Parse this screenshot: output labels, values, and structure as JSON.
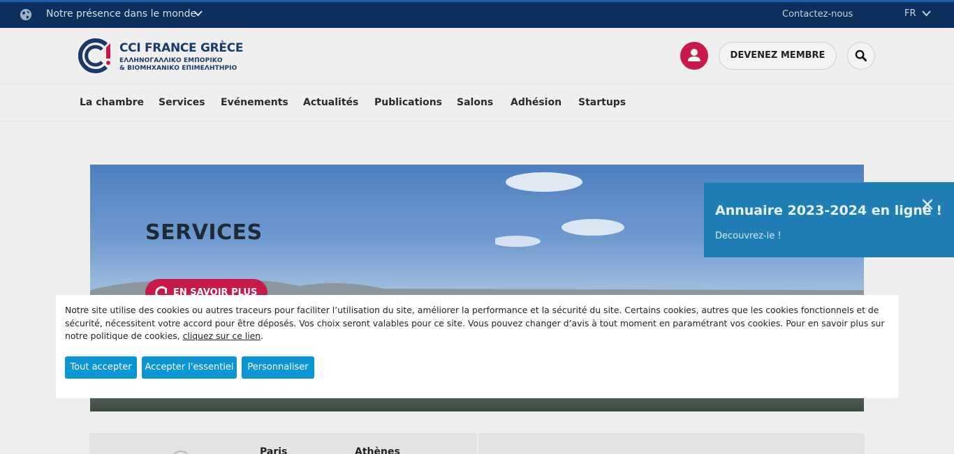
{
  "topbar": {
    "presence_label": "Notre présence dans le monde",
    "contact_label": "Contactez-nous",
    "lang_label": "FR",
    "icons": [
      "globe-icon",
      "chevron-down-icon"
    ]
  },
  "header": {
    "logo_title": "CCI FRANCE GRÈCE",
    "logo_sub1": "ΕΛΛΗΝΟΓΑΛΛΙΚΟ ΕΜΠΟΡΙΚΟ",
    "logo_sub2": "& ΒΙΟΜΗΧΑΝΙΚΟ ΕΠΙΜΕΛΗΤΗΡΙΟ",
    "member_label": "DEVENEZ MEMBRE",
    "icons": [
      "user-icon",
      "search-icon"
    ]
  },
  "nav": {
    "items": [
      "La chambre",
      "Services",
      "Evénements",
      "Actualités",
      "Publications",
      "Salons",
      "Adhésion",
      "Startups"
    ]
  },
  "hero": {
    "title": "SERVICES",
    "button_label": "EN SAVOIR PLUS"
  },
  "popup": {
    "title": "Annuaire 2023-2024 en ligne !",
    "link_label": "Decouvrez-le !"
  },
  "strip": {
    "city1": "Paris",
    "city2": "Athènes"
  },
  "cookie": {
    "text": "Notre site utilise des cookies ou autres traceurs pour faciliter l’utilisation du site, améliorer la performance et la sécurité du site. Certains cookies, autres que les cookies fonctionnels et de sécurité, nécessitent votre accord pour être déposés. Vos choix seront valables pour ce site. Vous pouvez changer d’avis à tout moment en paramétrant vos cookies. Pour en savoir plus sur notre politique de cookies, ",
    "link_label": "cliquez sur ce lien",
    "text_end": ".",
    "buttons": {
      "accept_all": "Tout accepter",
      "accept_essential": "Accepter l'essentiel",
      "customize": "Personnaliser"
    }
  },
  "colors": {
    "topbar": "#0c2f5b",
    "brand_red": "#c8194a",
    "popup_blue": "#1f7fb5",
    "cookie_button": "#0a96d6"
  }
}
